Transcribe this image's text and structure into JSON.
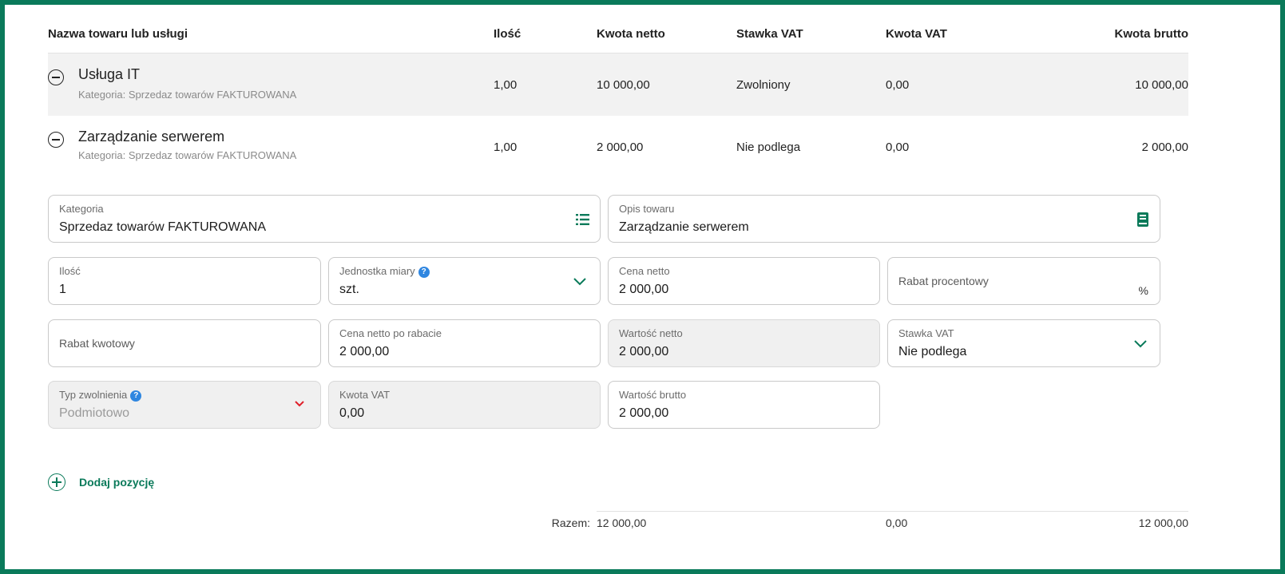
{
  "table": {
    "headers": {
      "name": "Nazwa towaru lub usługi",
      "qty": "Ilość",
      "net": "Kwota netto",
      "vat_rate": "Stawka VAT",
      "vat_amount": "Kwota VAT",
      "gross": "Kwota brutto"
    },
    "rows": [
      {
        "name": "Usługa IT",
        "category": "Kategoria: Sprzedaz towarów FAKTUROWANA",
        "qty": "1,00",
        "net": "10 000,00",
        "vat_rate": "Zwolniony",
        "vat_amount": "0,00",
        "gross": "10 000,00"
      },
      {
        "name": "Zarządzanie serwerem",
        "category": "Kategoria: Sprzedaz towarów FAKTUROWANA",
        "qty": "1,00",
        "net": "2 000,00",
        "vat_rate": "Nie podlega",
        "vat_amount": "0,00",
        "gross": "2 000,00"
      }
    ]
  },
  "form": {
    "category": {
      "label": "Kategoria",
      "value": "Sprzedaz towarów FAKTUROWANA"
    },
    "description": {
      "label": "Opis towaru",
      "value": "Zarządzanie serwerem"
    },
    "quantity": {
      "label": "Ilość",
      "value": "1"
    },
    "unit": {
      "label": "Jednostka miary",
      "value": "szt."
    },
    "net_price": {
      "label": "Cena netto",
      "value": "2 000,00"
    },
    "percent_discount": {
      "placeholder": "Rabat procentowy",
      "suffix": "%"
    },
    "amount_discount": {
      "placeholder": "Rabat kwotowy"
    },
    "net_after_discount": {
      "label": "Cena netto po rabacie",
      "value": "2 000,00"
    },
    "net_value": {
      "label": "Wartość netto",
      "value": "2 000,00"
    },
    "vat_rate": {
      "label": "Stawka VAT",
      "value": "Nie podlega"
    },
    "exemption_type": {
      "label": "Typ zwolnienia",
      "value": "Podmiotowo"
    },
    "vat_amount": {
      "label": "Kwota VAT",
      "value": "0,00"
    },
    "gross_value": {
      "label": "Wartość brutto",
      "value": "2 000,00"
    }
  },
  "add_item": {
    "label": "Dodaj pozycję"
  },
  "totals": {
    "label": "Razem:",
    "net": "12 000,00",
    "vat": "0,00",
    "gross": "12 000,00"
  },
  "colors": {
    "frame": "#0a7a5a",
    "accent": "#0a7a5a",
    "error": "#e0202a",
    "info": "#2f86e0"
  },
  "icons": {
    "row_toggle": "minus-circle-icon",
    "category_picker": "list-icon",
    "description_book": "book-icon",
    "dropdown": "chevron-down-icon",
    "help": "question-icon",
    "add": "plus-circle-icon"
  }
}
